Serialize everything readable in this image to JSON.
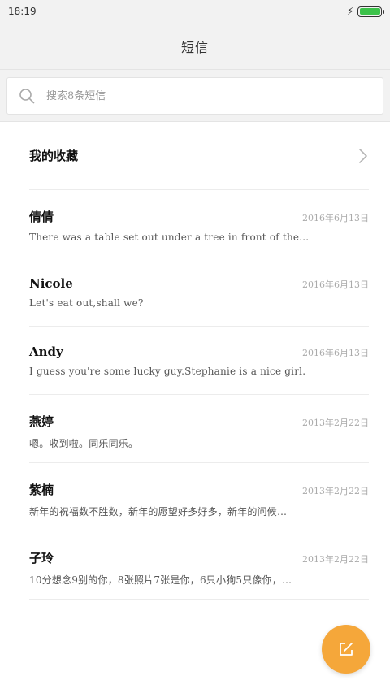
{
  "status_bar": {
    "time": "18:19"
  },
  "header": {
    "title": "短信"
  },
  "search": {
    "placeholder": "搜索8条短信"
  },
  "favorites": {
    "label": "我的收藏"
  },
  "conversations": [
    {
      "name": "倩倩",
      "date": "2016年6月13日",
      "snippet": "There was a table set out under a tree in front of the…"
    },
    {
      "name": "Nicole",
      "date": "2016年6月13日",
      "snippet": "Let's eat out,shall we?"
    },
    {
      "name": "Andy",
      "date": "2016年6月13日",
      "snippet": "I guess you're some lucky guy.Stephanie is a nice girl."
    },
    {
      "name": "燕婷",
      "date": "2013年2月22日",
      "snippet": "嗯。收到啦。同乐同乐。"
    },
    {
      "name": "紫楠",
      "date": "2013年2月22日",
      "snippet": "新年的祝福数不胜数，新年的愿望好多好多，新年的问候…"
    },
    {
      "name": "子玲",
      "date": "2013年2月22日",
      "snippet": "10分想念9别的你，8张照片7张是你，6只小狗5只像你，…"
    }
  ],
  "colors": {
    "accent": "#f5a73a",
    "battery": "#3cc24a"
  },
  "battery_level": 1.0
}
